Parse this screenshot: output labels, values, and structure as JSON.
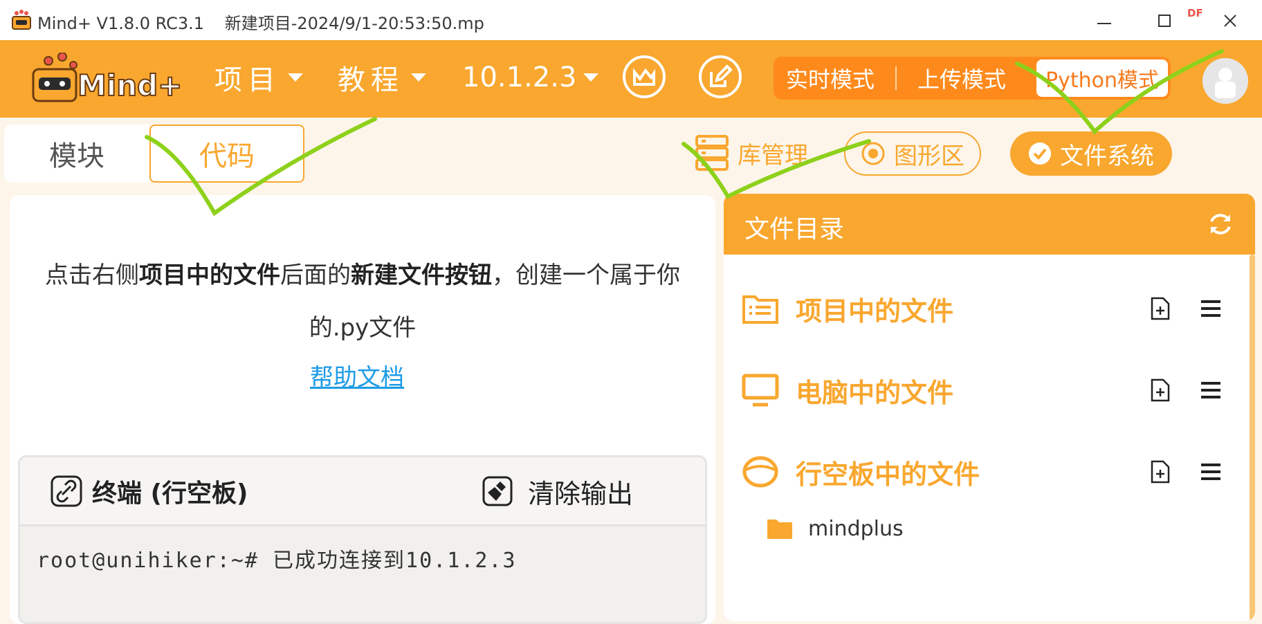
{
  "window": {
    "app_title": "Mind+ V1.8.0 RC3.1",
    "file_title": "新建项目-2024/9/1-20:53:50.mp",
    "badge": "DF"
  },
  "header": {
    "menu": {
      "project": "项目",
      "tutorial": "教程",
      "device_ip": "10.1.2.3"
    },
    "modes": {
      "realtime": "实时模式",
      "upload": "上传模式",
      "python": "Python模式"
    }
  },
  "tabs": {
    "blocks": "模块",
    "code": "代码"
  },
  "toolbar": {
    "library_manager": "库管理",
    "graphic_area": "图形区",
    "file_system": "文件系统"
  },
  "editor": {
    "hint_part1": "点击右侧",
    "hint_bold1": "项目中的文件",
    "hint_part2": "后面的",
    "hint_bold2": "新建文件按钮",
    "hint_part3": "，创建一个属于你的.py文件",
    "help_link": "帮助文档"
  },
  "terminal": {
    "title": "终端 (行空板)",
    "clear_label": "清除输出",
    "output": "root@unihiker:~# 已成功连接到10.1.2.3"
  },
  "file_panel": {
    "title": "文件目录",
    "sections": [
      {
        "label": "项目中的文件",
        "icon": "list-folder-icon"
      },
      {
        "label": "电脑中的文件",
        "icon": "monitor-icon"
      },
      {
        "label": "行空板中的文件",
        "icon": "board-icon"
      }
    ],
    "board_files": [
      {
        "name": "mindplus",
        "icon": "folder-icon"
      }
    ]
  },
  "colors": {
    "brand_orange": "#f9a72f",
    "mode_orange": "#ff8a1c",
    "link_blue": "#1e9be6",
    "annotation_green": "#8ed11b"
  }
}
